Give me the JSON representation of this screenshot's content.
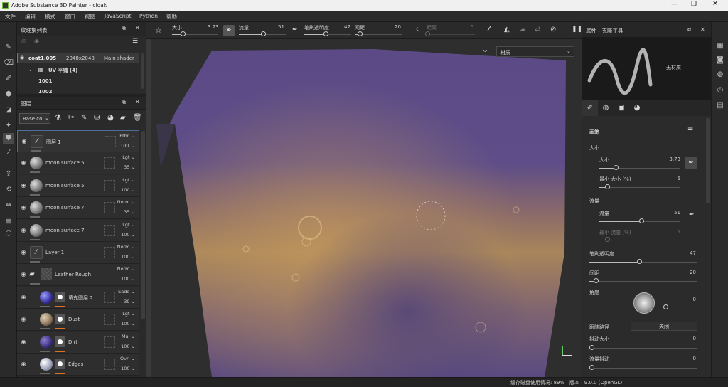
{
  "window": {
    "title": "Adobe Substance 3D Painter - cloak"
  },
  "menu": [
    "文件",
    "编辑",
    "模式",
    "窗口",
    "视图",
    "JavaScript",
    "Python",
    "帮助"
  ],
  "texture_set_panel": {
    "title": "纹理集列表",
    "item": {
      "name": "coat1.005",
      "resolution": "2048x2048",
      "shader": "Main shader"
    },
    "uv_label": "UV 平铺 (4)",
    "udims": [
      "1001",
      "1002"
    ]
  },
  "layers_panel": {
    "title": "图层",
    "channel": "Base co",
    "layers": [
      {
        "name": "图层 1",
        "blend": "Pthr",
        "opacity": "100",
        "thumb": "brush-icon"
      },
      {
        "name": "moon surface 5",
        "blend": "Lgt",
        "opacity": "35",
        "thumb": "sphere"
      },
      {
        "name": "moon surface 5",
        "blend": "Lgt",
        "opacity": "100",
        "thumb": "sphere"
      },
      {
        "name": "moon surface 7",
        "blend": "Norm",
        "opacity": "35",
        "thumb": "sphere"
      },
      {
        "name": "moon surface 7",
        "blend": "Lgt",
        "opacity": "100",
        "thumb": "sphere"
      },
      {
        "name": "Layer 1",
        "blend": "Norm",
        "opacity": "100",
        "thumb": "brush-icon"
      },
      {
        "name": "Leather Rough",
        "blend": "Norm",
        "opacity": "100",
        "thumb": "folder"
      },
      {
        "name": "填充图层 2",
        "blend": "Sadd",
        "opacity": "39",
        "thumb": "fill-blue"
      },
      {
        "name": "Dust",
        "blend": "Lgt",
        "opacity": "100",
        "thumb": "fill-tan"
      },
      {
        "name": "Dirt",
        "blend": "Mul",
        "opacity": "100",
        "thumb": "fill-dark"
      },
      {
        "name": "Edges",
        "blend": "Ovrl",
        "opacity": "100",
        "thumb": "fill-light"
      }
    ]
  },
  "toolbar": {
    "size_label": "大小",
    "size_value": "3.73",
    "flow_label": "流量",
    "flow_value": "51",
    "opacity_label": "笔刷透明度",
    "opacity_value": "47",
    "spacing_label": "间距",
    "spacing_value": "20",
    "distance_label": "距离",
    "distance_value": "5"
  },
  "viewport": {
    "material_select": "材质"
  },
  "properties": {
    "title": "属性 - 克隆工具",
    "material_label": "无材质",
    "section_brush": "画笔",
    "size_group": "大小",
    "size_label": "大小",
    "size_value": "3.73",
    "min_size_label": "最小 大小 (%)",
    "min_size_value": "5",
    "flow_group": "流量",
    "flow_label": "流量",
    "flow_value": "51",
    "min_flow_label": "最小 流量 (%)",
    "min_flow_value": "5",
    "brush_opacity_label": "笔刷透明度",
    "brush_opacity_value": "47",
    "spacing_label": "间距",
    "spacing_value": "20",
    "angle_label": "角度",
    "angle_value": "0",
    "follow_path_label": "跟随路径",
    "follow_path_value": "关闭",
    "jitter_size_label": "抖动大小",
    "jitter_size_value": "0",
    "flow_jitter_label": "流量抖动",
    "flow_jitter_value": "0"
  },
  "status": {
    "text": "缓存磁盘使用情况: 89% | 版本 : 9.0.0 (OpenGL)"
  }
}
